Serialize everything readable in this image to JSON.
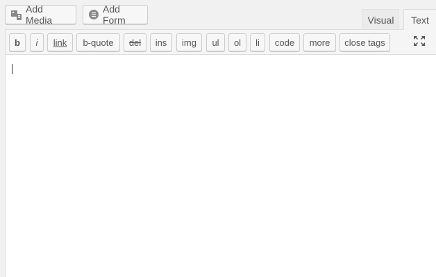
{
  "media_buttons": {
    "add_media_label": "Add Media",
    "add_form_label": "Add Form"
  },
  "editor_tabs": {
    "visual_label": "Visual",
    "text_label": "Text",
    "active": "Text"
  },
  "quicktags": [
    {
      "id": "b",
      "label": "b"
    },
    {
      "id": "i",
      "label": "i"
    },
    {
      "id": "link",
      "label": "link"
    },
    {
      "id": "b-quote",
      "label": "b-quote"
    },
    {
      "id": "del",
      "label": "del"
    },
    {
      "id": "ins",
      "label": "ins"
    },
    {
      "id": "img",
      "label": "img"
    },
    {
      "id": "ul",
      "label": "ul"
    },
    {
      "id": "ol",
      "label": "ol"
    },
    {
      "id": "li",
      "label": "li"
    },
    {
      "id": "code",
      "label": "code"
    },
    {
      "id": "more",
      "label": "more"
    },
    {
      "id": "close-tags",
      "label": "close tags"
    }
  ],
  "icons": {
    "add_media": "media-icon",
    "add_form": "form-icon",
    "fullscreen": "fullscreen-icon"
  },
  "content": {
    "text": ""
  },
  "colors": {
    "background": "#f1f1f1",
    "button_text": "#555555",
    "border": "#dddddd",
    "editor_bg": "#ffffff"
  }
}
